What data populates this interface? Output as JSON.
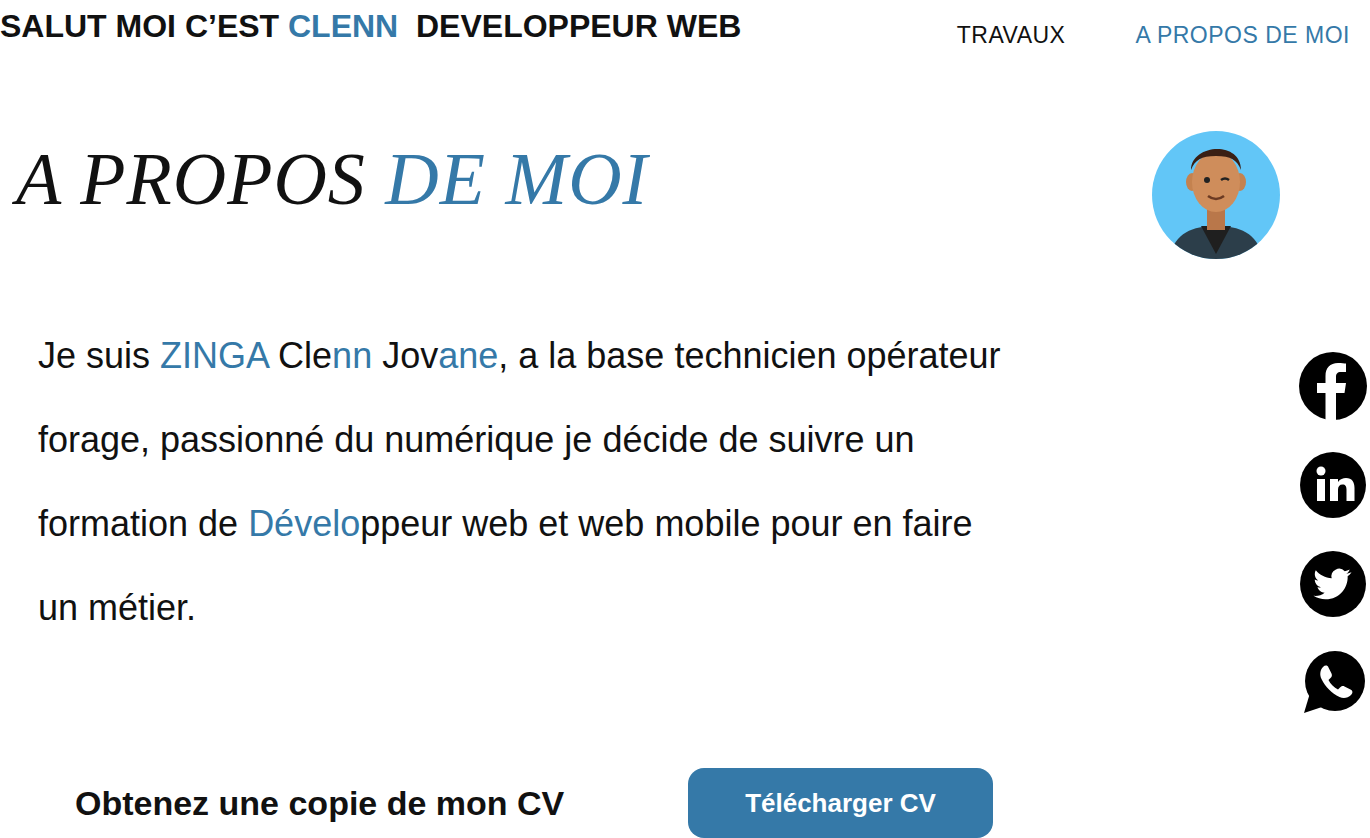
{
  "header": {
    "title": [
      {
        "text": "SALUT MOI C’EST ",
        "highlight": false
      },
      {
        "text": "CLENN",
        "highlight": true
      },
      {
        "text": "  DEVELOPPEUR WEB",
        "highlight": false
      }
    ]
  },
  "nav": [
    {
      "label": "TRAVAUX",
      "selected": false
    },
    {
      "label": "A PROPOS DE MOI",
      "selected": true
    }
  ],
  "heading": [
    {
      "text": "A PROPOS ",
      "highlight": false
    },
    {
      "text": "DE MOI",
      "highlight": true
    }
  ],
  "intro": [
    {
      "text": "Je suis ",
      "highlight": false
    },
    {
      "text": "ZINGA",
      "highlight": true
    },
    {
      "text": " Cle",
      "highlight": false
    },
    {
      "text": "nn",
      "highlight": true
    },
    {
      "text": " Jov",
      "highlight": false
    },
    {
      "text": "ane",
      "highlight": true
    },
    {
      "text": ", a la base technicien opérateur forage, passionné du numérique je décide de suivre un formation de ",
      "highlight": false
    },
    {
      "text": "Dévelo",
      "highlight": true
    },
    {
      "text": "ppeur web et web mobile pour en faire un métier.",
      "highlight": false
    }
  ],
  "cv": {
    "label": "Obtenez une copie de mon CV",
    "button": "Télécharger CV"
  }
}
